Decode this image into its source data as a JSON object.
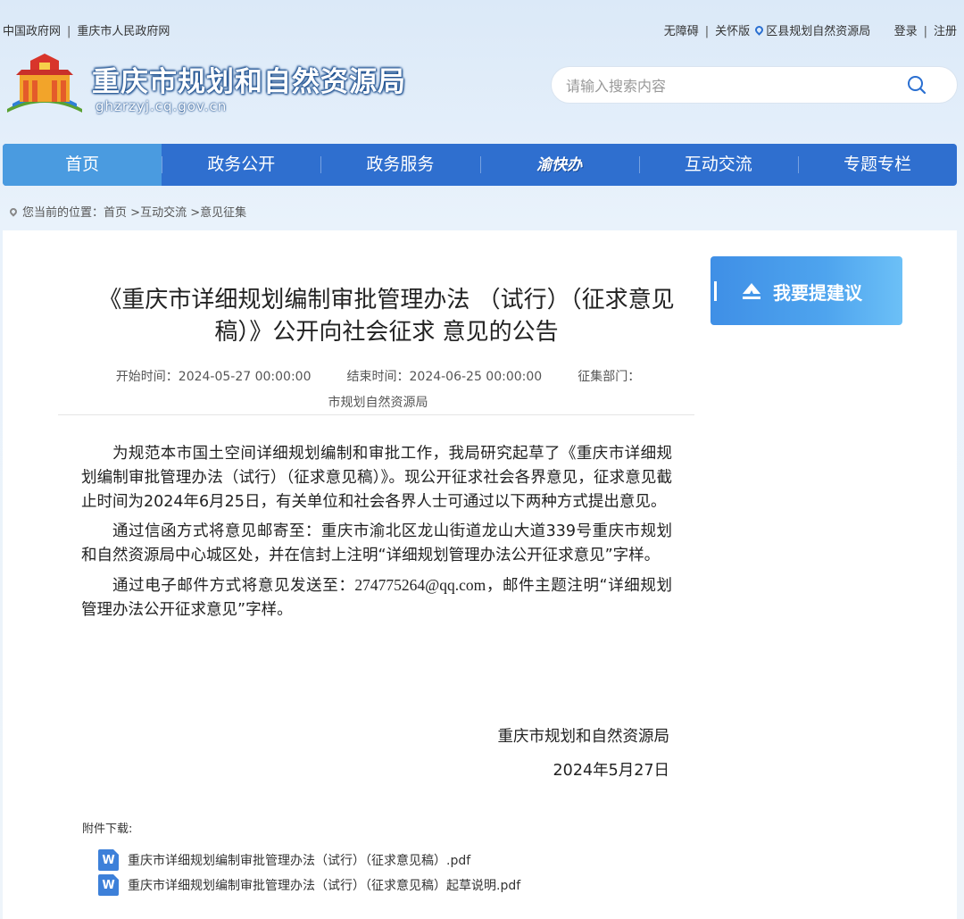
{
  "topbar": {
    "left_links": [
      "中国政府网",
      "重庆市人民政府网"
    ],
    "accessibility": "无障碍",
    "care_mode": "关怀版",
    "district_bureau": "区县规划自然资源局",
    "login": "登录",
    "register": "注册"
  },
  "header": {
    "site_title": "重庆市规划和自然资源局",
    "domain": "ghzrzyj.cq.gov.cn",
    "search_placeholder": "请输入搜索内容"
  },
  "nav": {
    "items": [
      "首页",
      "政务公开",
      "政务服务",
      "渝快办",
      "互动交流",
      "专题专栏"
    ],
    "active_index": 0
  },
  "breadcrumb": {
    "prefix": "您当前的位置：",
    "items": [
      "首页",
      "互动交流",
      "意见征集"
    ],
    "sep": " >"
  },
  "article": {
    "title": "《重庆市详细规划编制审批管理办法 （试行）（征求意见稿）》公开向社会征求 意见的公告",
    "start_time": "开始时间：2024-05-27 00:00:00",
    "end_time": "结束时间：2024-06-25 00:00:00",
    "department_label": "征集部门：",
    "department": "市规划自然资源局",
    "paragraphs": [
      "为规范本市国土空间详细规划编制和审批工作，我局研究起草了《重庆市详细规划编制审批管理办法（试行）（征求意见稿）》。现公开征求社会各界意见，征求意见截止时间为2024年6月25日，有关单位和社会各界人士可通过以下两种方式提出意见。",
      "通过信函方式将意见邮寄至：重庆市渝北区龙山街道龙山大道339号重庆市规划和自然资源局中心城区处，并在信封上注明“详细规划管理办法公开征求意见”字样。"
    ],
    "p3_before": "通过电子邮件方式将意见发送至：",
    "p3_email": "274775264@qq.com",
    "p3_after": "，邮件主题注明“详细规划管理办法公开征求意见”字样。",
    "sign_org": "重庆市规划和自然资源局",
    "sign_date": "2024年5月27日",
    "attachments_label": "附件下载:",
    "attachments": [
      "重庆市详细规划编制审批管理办法（试行）（征求意见稿）.pdf",
      "重庆市详细规划编制审批管理办法（试行）（征求意见稿）起草说明.pdf"
    ],
    "file_icon_letter": "W"
  },
  "sidebar": {
    "suggest_button": "我要提建议"
  },
  "colors": {
    "nav_bg": "#2f6fcf",
    "nav_active": "#4a9be0",
    "accent": "#3d80d9"
  }
}
